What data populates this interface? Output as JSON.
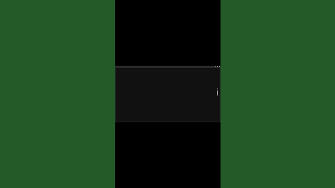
{
  "terminal": {
    "title": "",
    "lines": [
      {
        "text": "",
        "kind": "prompt"
      },
      {
        "text": "",
        "kind": "dim"
      },
      {
        "text": "",
        "kind": "dim"
      },
      {
        "text": "",
        "kind": "gap"
      },
      {
        "text": "",
        "kind": "dim"
      },
      {
        "text": "",
        "kind": "dim"
      },
      {
        "text": "",
        "kind": "ok"
      },
      {
        "text": "",
        "kind": "dim"
      },
      {
        "text": "",
        "kind": "dim"
      },
      {
        "text": "",
        "kind": "dim"
      },
      {
        "text": "",
        "kind": "gap"
      },
      {
        "text": "",
        "kind": "dim"
      },
      {
        "text": "",
        "kind": "dim"
      },
      {
        "text": "",
        "kind": "gap"
      },
      {
        "text": "",
        "kind": "prompt"
      },
      {
        "text": "",
        "kind": "dim"
      },
      {
        "text": "",
        "kind": "dim"
      },
      {
        "text": "",
        "kind": "dim"
      },
      {
        "text": "",
        "kind": "gap"
      },
      {
        "text": "",
        "kind": "prompt"
      }
    ]
  },
  "colors": {
    "background_green": "#245a27",
    "terminal_bg": "#111111",
    "success_text": "#39c24a",
    "text": "#9da4a0"
  },
  "icons": {
    "scroll_up": "chevron-up-icon",
    "scroll_down": "chevron-down-icon"
  }
}
